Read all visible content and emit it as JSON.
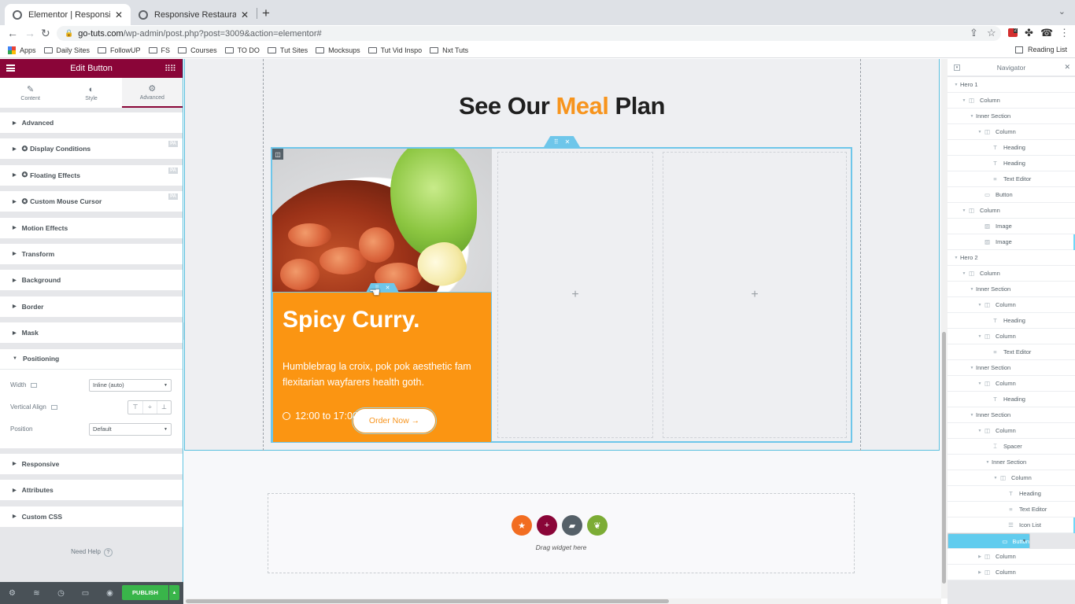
{
  "browser": {
    "tabs": [
      {
        "title": "Elementor | Responsive Restau",
        "active": true
      },
      {
        "title": "Responsive Restaurant Landin",
        "active": false
      }
    ],
    "new_tab": "+",
    "url_host": "go-tuts.com",
    "url_path": "/wp-admin/post.php?post=3009&action=elementor#",
    "extension_badge": "2",
    "bookmarks": [
      "Apps",
      "Daily Sites",
      "FollowUP",
      "FS",
      "Courses",
      "TO DO",
      "Tut Sites",
      "Mocksups",
      "Tut Vid Inspo",
      "Nxt Tuts"
    ],
    "reading_list": "Reading List"
  },
  "panel": {
    "title": "Edit Button",
    "tabs": [
      {
        "label": "Content",
        "icon": "pencil-icon"
      },
      {
        "label": "Style",
        "icon": "contrast-icon"
      },
      {
        "label": "Advanced",
        "icon": "gear-icon",
        "active": true
      }
    ],
    "sections": [
      {
        "label": "Advanced"
      },
      {
        "label": "Display Conditions",
        "pro": true,
        "badge": "PA"
      },
      {
        "label": "Floating Effects",
        "pro": true,
        "badge": "PA"
      },
      {
        "label": "Custom Mouse Cursor",
        "pro": true,
        "badge": "PA"
      },
      {
        "label": "Motion Effects"
      },
      {
        "label": "Transform"
      },
      {
        "label": "Background"
      },
      {
        "label": "Border"
      },
      {
        "label": "Mask"
      },
      {
        "label": "Positioning",
        "expanded": true
      },
      {
        "label": "Responsive"
      },
      {
        "label": "Attributes"
      },
      {
        "label": "Custom CSS"
      }
    ],
    "positioning": {
      "width_label": "Width",
      "width_value": "Inline (auto)",
      "valign_label": "Vertical Align",
      "position_label": "Position",
      "position_value": "Default"
    },
    "need_help": "Need Help",
    "publish": "PUBLISH"
  },
  "canvas": {
    "title_pre": "See Our ",
    "title_highlight": "Meal",
    "title_post": " Plan",
    "highlight_color": "#f7941d",
    "card": {
      "dish": "Spicy Curry.",
      "description": "Humblebrag la croix, pok pok aesthetic fam flexitarian wayfarers health goth.",
      "hours": "12:00 to 17:00",
      "button": "Order Now →",
      "bg_color": "#fb9512"
    },
    "add_placeholder": "+",
    "drag_text": "Drag widget here"
  },
  "navigator": {
    "title": "Navigator",
    "items": [
      {
        "label": "Hero 1",
        "type": "section",
        "depth": 0,
        "expanded": true
      },
      {
        "label": "Column",
        "type": "column",
        "depth": 1,
        "expanded": true
      },
      {
        "label": "Inner Section",
        "type": "section",
        "depth": 2,
        "expanded": true
      },
      {
        "label": "Column",
        "type": "column",
        "depth": 3,
        "expanded": true
      },
      {
        "label": "Heading",
        "type": "heading",
        "depth": 4
      },
      {
        "label": "Heading",
        "type": "heading",
        "depth": 4
      },
      {
        "label": "Text Editor",
        "type": "text",
        "depth": 4
      },
      {
        "label": "Button",
        "type": "button",
        "depth": 3
      },
      {
        "label": "Column",
        "type": "column",
        "depth": 1,
        "expanded": true
      },
      {
        "label": "Image",
        "type": "image",
        "depth": 3
      },
      {
        "label": "Image",
        "type": "image",
        "depth": 3
      },
      {
        "label": "Hero 2",
        "type": "section",
        "depth": 0,
        "expanded": true
      },
      {
        "label": "Column",
        "type": "column",
        "depth": 1,
        "expanded": true
      },
      {
        "label": "Inner Section",
        "type": "section",
        "depth": 2,
        "expanded": true
      },
      {
        "label": "Column",
        "type": "column",
        "depth": 3,
        "expanded": true
      },
      {
        "label": "Heading",
        "type": "heading",
        "depth": 4
      },
      {
        "label": "Column",
        "type": "column",
        "depth": 3,
        "expanded": true
      },
      {
        "label": "Text Editor",
        "type": "text",
        "depth": 4
      },
      {
        "label": "Inner Section",
        "type": "section",
        "depth": 2,
        "expanded": true
      },
      {
        "label": "Column",
        "type": "column",
        "depth": 3,
        "expanded": true
      },
      {
        "label": "Heading",
        "type": "heading",
        "depth": 4
      },
      {
        "label": "Inner Section",
        "type": "section",
        "depth": 2,
        "expanded": true
      },
      {
        "label": "Column",
        "type": "column",
        "depth": 3,
        "expanded": true
      },
      {
        "label": "Spacer",
        "type": "spacer",
        "depth": 4
      },
      {
        "label": "Inner Section",
        "type": "section",
        "depth": 4,
        "expanded": true
      },
      {
        "label": "Column",
        "type": "column",
        "depth": 5,
        "expanded": true
      },
      {
        "label": "Heading",
        "type": "heading",
        "depth": 6
      },
      {
        "label": "Text Editor",
        "type": "text",
        "depth": 6
      },
      {
        "label": "Icon List",
        "type": "list",
        "depth": 6
      },
      {
        "label": "Button",
        "type": "button",
        "depth": 6,
        "selected": true
      },
      {
        "label": "Column",
        "type": "column",
        "depth": 3,
        "expanded": false
      },
      {
        "label": "Column",
        "type": "column",
        "depth": 3,
        "expanded": false
      }
    ]
  }
}
